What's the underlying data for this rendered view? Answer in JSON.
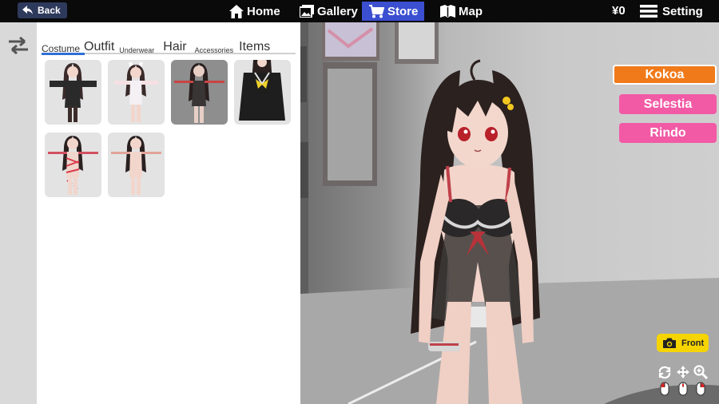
{
  "topbar": {
    "back_label": "Back",
    "nav": [
      {
        "label": "Home",
        "icon": "home-icon"
      },
      {
        "label": "Gallery",
        "icon": "gallery-icon"
      },
      {
        "label": "Store",
        "icon": "cart-icon",
        "active": true
      },
      {
        "label": "Map",
        "icon": "map-icon"
      }
    ],
    "money": "¥0",
    "setting_label": "Setting"
  },
  "panel": {
    "tabs": {
      "costume": "Costume",
      "outfit": "Outfit",
      "underwear": "Underwear",
      "hair": "Hair",
      "accessories": "Accessories",
      "items": "Items"
    },
    "active_tab": "Costume",
    "outfits": [
      {
        "name": "black-jacket-outfit",
        "selected": false
      },
      {
        "name": "white-bunny-outfit",
        "selected": false
      },
      {
        "name": "lingerie-outfit",
        "selected": true
      },
      {
        "name": "sailor-uniform-outfit",
        "selected": false
      },
      {
        "name": "rope-outfit",
        "selected": false
      },
      {
        "name": "nude-outfit",
        "selected": false
      }
    ]
  },
  "characters": [
    {
      "label": "Kokoa",
      "active": true
    },
    {
      "label": "Selestia",
      "active": false
    },
    {
      "label": "Rindo",
      "active": false
    }
  ],
  "camera": {
    "front_label": "Front"
  },
  "colors": {
    "active_character": "#f07a1a",
    "character_button": "#f25aa5",
    "store_active": "#3b4fd0",
    "tab_underline": "#2f6fd6",
    "front_button": "#f5d400"
  }
}
